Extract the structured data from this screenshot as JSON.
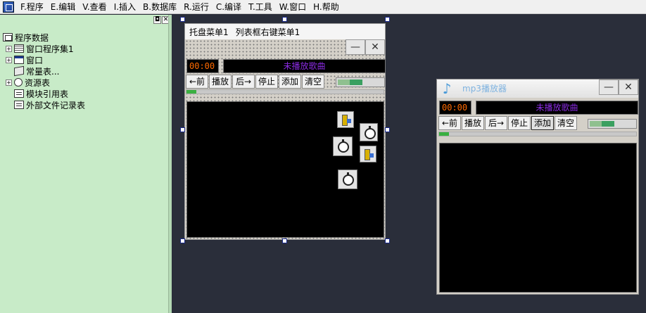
{
  "menubar": {
    "items": [
      {
        "label": "F.程序"
      },
      {
        "label": "E.编辑"
      },
      {
        "label": "V.查看"
      },
      {
        "label": "I.插入"
      },
      {
        "label": "B.数据库"
      },
      {
        "label": "R.运行"
      },
      {
        "label": "C.编译"
      },
      {
        "label": "T.工具"
      },
      {
        "label": "W.窗口"
      },
      {
        "label": "H.帮助"
      }
    ]
  },
  "tree_panel": {
    "pin_glyph": "◘",
    "close_glyph": "✕",
    "root": "程序数据",
    "items": [
      {
        "label": "窗口程序集1",
        "expander": "+"
      },
      {
        "label": "窗口",
        "expander": "+"
      },
      {
        "label": "常量表...",
        "expander": ""
      },
      {
        "label": "资源表",
        "expander": "+"
      },
      {
        "label": "模块引用表",
        "expander": ""
      },
      {
        "label": "外部文件记录表",
        "expander": ""
      }
    ]
  },
  "designer": {
    "menus": [
      "托盘菜单1",
      "列表框右键菜单1"
    ],
    "minimize_glyph": "—",
    "close_glyph": "✕",
    "time": "00:00",
    "song": "未播放歌曲",
    "buttons": [
      "←前",
      "播放",
      "后→",
      "停止",
      "添加",
      "清空"
    ],
    "volume_level": 0.55,
    "progress_level": 0.05
  },
  "player": {
    "title": "mp3播放器",
    "icon_glyph": "♪",
    "minimize_glyph": "—",
    "close_glyph": "✕",
    "time": "00:00",
    "song": "未播放歌曲",
    "buttons": [
      "←前",
      "播放",
      "后→",
      "停止",
      "添加",
      "清空"
    ],
    "volume_level": 0.55,
    "progress_level": 0.05,
    "colors": {
      "time": "#ff6a00",
      "song": "#8a2be2",
      "title": "#7fb3e0"
    }
  }
}
